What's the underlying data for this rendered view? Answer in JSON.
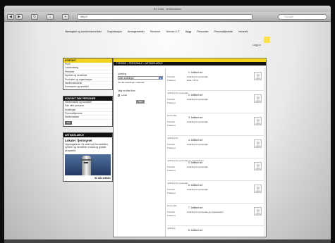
{
  "window": {
    "title": "BV Intra - Artikkelarkiv"
  },
  "browser": {
    "nav_back": "◀",
    "nav_forward": "▶",
    "reload": "↻",
    "home": "⌂",
    "bookmark": "+",
    "url": "http://",
    "search_placeholder": "Google"
  },
  "topnav": {
    "items": [
      "Næringsliv og samfunnsområdet",
      "Organisasjon",
      "Arrangementer",
      "Personer",
      "Service & IT",
      "Bygg",
      "Personale",
      "Personaltjeneste",
      "Intranett"
    ]
  },
  "user": {
    "label": "Logg ut"
  },
  "sidebar": {
    "box1": {
      "title": "KONTAKT",
      "items": [
        "Profil",
        "Lokalordning",
        "Personer",
        "Nyheter og hendelser",
        "Produkter og organisasjon",
        "Medlemsfordeler",
        "Kommuner og områder"
      ]
    },
    "box2": {
      "title": "KONTAKT SØK PERSONER",
      "items": [
        "Medlemsliste og kontakter",
        "Søk etter personer",
        "Avdelinger",
        "Personaltjeneste",
        "Medlemslister"
      ],
      "search_btn": "Søk"
    },
    "news": {
      "head": "ARTIKKELARKIV",
      "title": "Lokale i fjernsynet",
      "text": "Oppslagstavle: Se siste nytt fra bedriften, nyheter og hendelser i lokalt og globalt perspektiv.",
      "more": "Se alle artikler"
    }
  },
  "main": {
    "breadcrumb": "FORSIDE > PERSONALE > ARTIKKELARKIV",
    "filter": {
      "label": "Avdeling",
      "selected": "Alle avdelinger",
      "link": "Vis alle avdelinger i kalender",
      "check_title": "Velg en eller flere",
      "check_label": "Lokalt",
      "button": "Søk"
    },
    "entries": [
      {
        "cat": "",
        "title": "1. Artikkel om",
        "l1": "Forfatter",
        "d1": "Avdeling for personale",
        "l2": "Publisert",
        "d2": "Dato: 15.06"
      },
      {
        "cat": "Avdeling for personale",
        "title": "2. Artikkel om",
        "l1": "Forfatter",
        "d1": "Avdeling for personale",
        "l2": "Publisert",
        "d2": ""
      },
      {
        "cat": "Personale",
        "title": "3. Artikkel om",
        "l1": "Forfatter",
        "d1": "Avdeling for personale",
        "l2": "Publisert",
        "d2": ""
      },
      {
        "cat": "Avdeling for",
        "title": "4. Artikkel om",
        "l1": "Forfatter",
        "d1": "Avdeling for personale",
        "l2": "Publisert",
        "d2": ""
      },
      {
        "cat": "Avdeling for personale og organisasjon",
        "title": "5. Artikkel om",
        "l1": "Forfatter",
        "d1": "Avdeling for personale",
        "l2": "Publisert",
        "d2": ""
      },
      {
        "cat": "Avdeling for personale",
        "title": "6. Artikkel om",
        "l1": "Forfatter",
        "d1": "Avdeling for personale",
        "l2": "Publisert",
        "d2": ""
      },
      {
        "cat": "Personale",
        "title": "7. Artikkel om",
        "l1": "Forfatter",
        "d1": "Avdeling for personale og organisasjon",
        "l2": "Publisert",
        "d2": ""
      },
      {
        "cat": "Avdeling",
        "title": "8. Artikkel om",
        "l1": "",
        "d1": "",
        "l2": "",
        "d2": ""
      }
    ]
  },
  "colors": {
    "accent": "#f4d31b",
    "dark": "#111111"
  }
}
